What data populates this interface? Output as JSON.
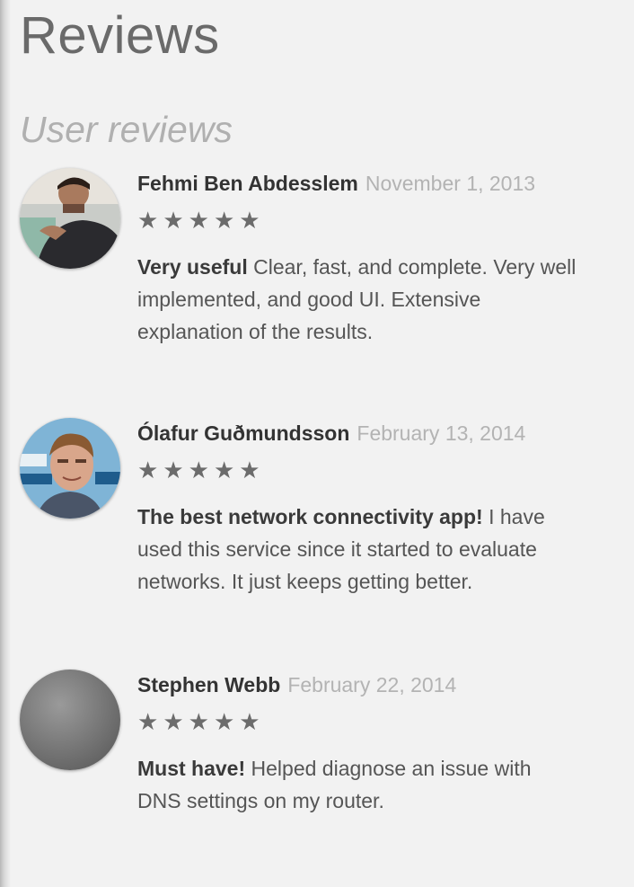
{
  "page": {
    "title": "Reviews",
    "section_title": "User reviews"
  },
  "reviews": [
    {
      "name": "Fehmi Ben Abdesslem",
      "date": "November 1, 2013",
      "rating": 5,
      "headline": "Very useful",
      "text": " Clear, fast, and complete. Very well\nimplemented, and good UI. Extensive\nexplanation of the results.",
      "avatar": "avatar-photo-man-dark-jacket"
    },
    {
      "name": "Ólafur Guðmundsson",
      "date": "February 13, 2014",
      "rating": 5,
      "headline": "The best network connectivity app!",
      "text": " I have\nused this service since it started to evaluate\nnetworks. It just keeps getting better.",
      "avatar": "avatar-photo-man-blue-background"
    },
    {
      "name": "Stephen Webb",
      "date": "February 22, 2014",
      "rating": 5,
      "headline": "Must have!",
      "text": " Helped diagnose an issue with\nDNS settings on my router.",
      "avatar": "avatar-gray-placeholder"
    }
  ],
  "colors": {
    "background": "#f2f2f2",
    "star": "#6c6c6c",
    "date": "#b3b3b3",
    "name": "#333333"
  }
}
